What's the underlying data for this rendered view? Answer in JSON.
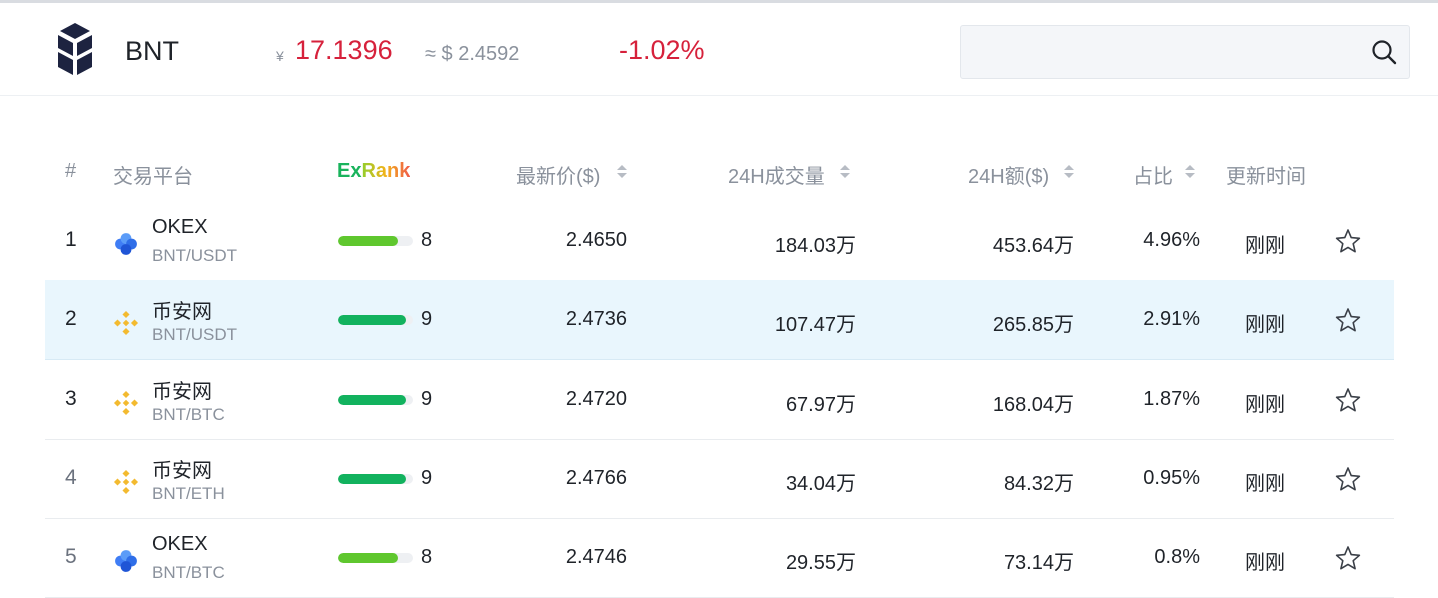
{
  "coin": {
    "symbol": "BNT",
    "cny_symbol": "¥",
    "cny_price": "17.1396",
    "usd_price": "≈ $ 2.4592",
    "change": "-1.02%"
  },
  "search": {
    "placeholder": "",
    "icon": "search-icon"
  },
  "colors": {
    "down": "#d6213b",
    "highlight_row": "#e9f6fd",
    "bar_8": "#5fc72e",
    "bar_9": "#12b25e"
  },
  "table": {
    "headers": {
      "index": "#",
      "exchange": "交易平台",
      "exrank_ex": "Ex",
      "exrank_rank": "Rank",
      "price": "最新价($)",
      "volume": "24H成交量",
      "amount": "24H额($)",
      "share": "占比",
      "updated": "更新时间"
    },
    "rows": [
      {
        "rank": "1",
        "exchange": "OKEX",
        "pair": "BNT/USDT",
        "icon": "okex-icon",
        "score": "8",
        "score_fraction": 0.8,
        "price": "2.4650",
        "volume": "184.03万",
        "amount": "453.64万",
        "share": "4.96%",
        "updated": "刚刚",
        "highlighted": false
      },
      {
        "rank": "2",
        "exchange": "币安网",
        "pair": "BNT/USDT",
        "icon": "binance-icon",
        "score": "9",
        "score_fraction": 0.9,
        "price": "2.4736",
        "volume": "107.47万",
        "amount": "265.85万",
        "share": "2.91%",
        "updated": "刚刚",
        "highlighted": true
      },
      {
        "rank": "3",
        "exchange": "币安网",
        "pair": "BNT/BTC",
        "icon": "binance-icon",
        "score": "9",
        "score_fraction": 0.9,
        "price": "2.4720",
        "volume": "67.97万",
        "amount": "168.04万",
        "share": "1.87%",
        "updated": "刚刚",
        "highlighted": false
      },
      {
        "rank": "4",
        "exchange": "币安网",
        "pair": "BNT/ETH",
        "icon": "binance-icon",
        "score": "9",
        "score_fraction": 0.9,
        "price": "2.4766",
        "volume": "34.04万",
        "amount": "84.32万",
        "share": "0.95%",
        "updated": "刚刚",
        "highlighted": false
      },
      {
        "rank": "5",
        "exchange": "OKEX",
        "pair": "BNT/BTC",
        "icon": "okex-icon",
        "score": "8",
        "score_fraction": 0.8,
        "price": "2.4746",
        "volume": "29.55万",
        "amount": "73.14万",
        "share": "0.8%",
        "updated": "刚刚",
        "highlighted": false
      }
    ]
  }
}
